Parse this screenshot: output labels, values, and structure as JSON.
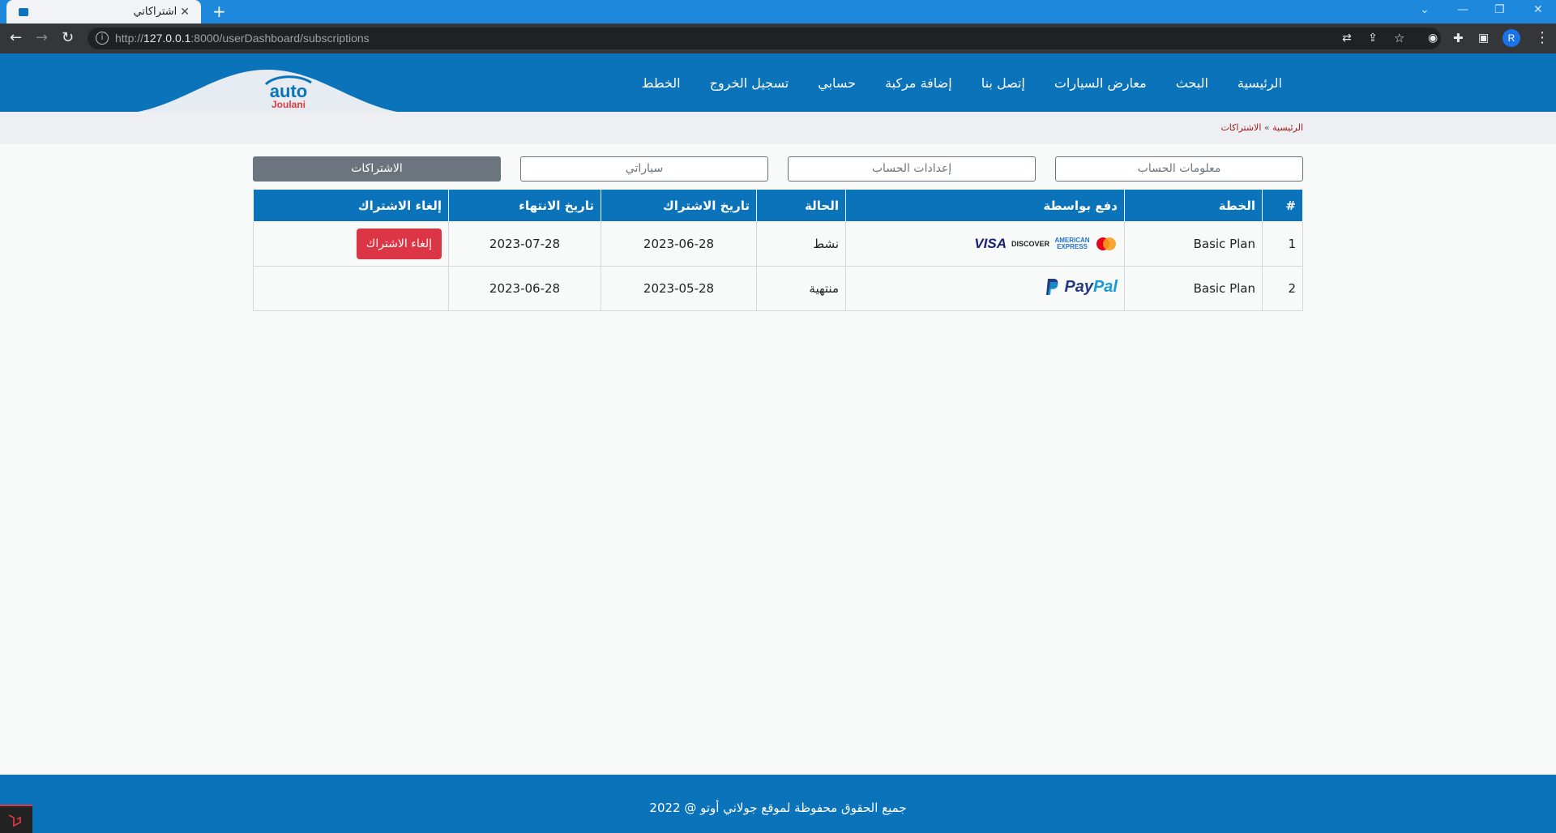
{
  "browser": {
    "tab_title": "اشتراكاتي",
    "url_prefix": "http://",
    "url_host": "127.0.0.1",
    "url_rest": ":8000/userDashboard/subscriptions",
    "profile_initial": "R"
  },
  "brand": {
    "logo_main": "auto",
    "logo_sub": "Joulani",
    "primary_color": "#0b73b9"
  },
  "nav": {
    "items": [
      "الرئيسية",
      "البحث",
      "معارض السيارات",
      "إتصل بنا",
      "إضافة مركبة",
      "حسابي",
      "تسجيل الخروج",
      "الخطط"
    ]
  },
  "breadcrumb": {
    "home": "الرئيسية",
    "separator": "»",
    "current": "الاشتراكات"
  },
  "tabs": [
    "معلومات الحساب",
    "إعدادات الحساب",
    "سياراتي",
    "الاشتراكات"
  ],
  "table": {
    "headers": [
      "#",
      "الخطة",
      "دفع بواسطة",
      "الحالة",
      "تاريخ الاشتراك",
      "تاريخ الانتهاء",
      "إلغاء الاشتراك"
    ],
    "rows": [
      {
        "num": "1",
        "plan": "Basic Plan",
        "payment": "card",
        "status": "نشط",
        "start": "2023-06-28",
        "end": "2023-07-28",
        "cancel_label": "إلغاء الاشتراك"
      },
      {
        "num": "2",
        "plan": "Basic Plan",
        "payment": "paypal",
        "status": "منتهية",
        "start": "2023-05-28",
        "end": "2023-06-28",
        "cancel_label": ""
      }
    ],
    "card_logos": {
      "visa": "VISA",
      "discover": "DISCOVER",
      "amex": "AMERICAN EXPRESS"
    },
    "paypal_logo": {
      "p1": "Pay",
      "p2": "Pal"
    }
  },
  "footer": {
    "text": "جميع الحقوق محفوظة لموقع جولاني أوتو @ 2022"
  }
}
